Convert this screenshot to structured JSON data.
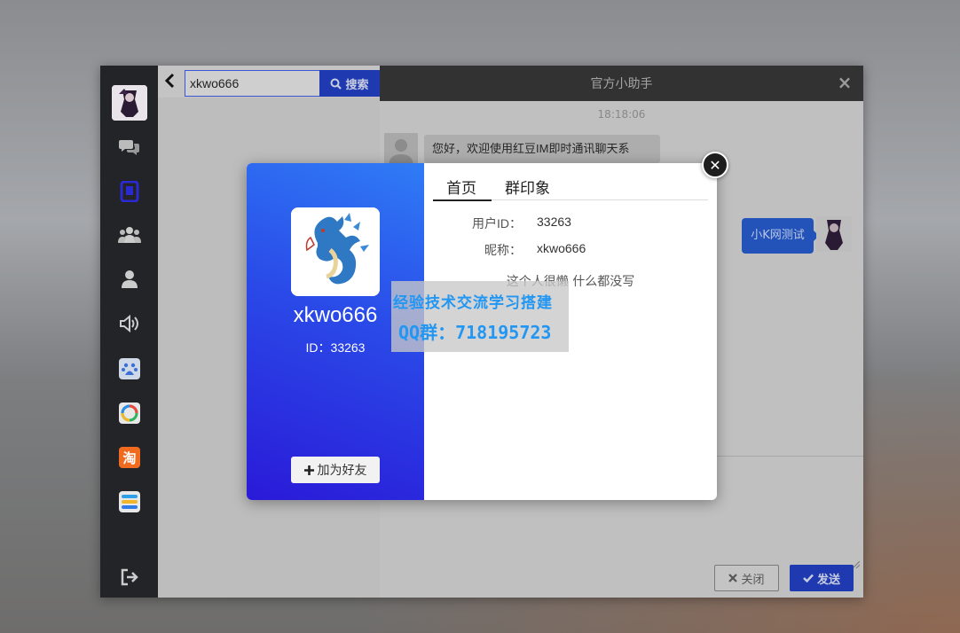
{
  "search": {
    "value": "xkwo666",
    "button_label": "搜索"
  },
  "chat": {
    "title": "官方小助手",
    "timestamp": "18:18:06",
    "incoming_message": "您好，欢迎使用红豆IM即时通讯聊天系",
    "outgoing_message": "小K网测试",
    "close_label": "关闭",
    "send_label": "发送"
  },
  "sidebar": {
    "icons": [
      "chat-icon",
      "tablet-icon",
      "group-icon",
      "contact-icon",
      "speaker-icon",
      "baidu-app-icon",
      "qq-app-icon",
      "taobao-app-icon",
      "layers-app-icon",
      "logout-icon"
    ],
    "taobao_label": "淘"
  },
  "profile": {
    "name": "xkwo666",
    "id_line": "ID：33263",
    "add_friend_label": "加为好友",
    "tabs": [
      "首页",
      "群印象"
    ],
    "fields": [
      {
        "key": "用户ID：",
        "value": "33263"
      },
      {
        "key": "昵称：",
        "value": "xkwo666"
      }
    ],
    "bio": "这个人很懒 什么都没写"
  },
  "watermark": {
    "line1": "经验技术交流学习搭建",
    "line2": "QQ群：718195723"
  },
  "colors": {
    "accent": "#1f3ab0",
    "sidebar_bg": "#232427",
    "profile_gradient_top": "#2f7cf6",
    "profile_gradient_bottom": "#2a1ad8",
    "watermark_text": "#2196f3"
  }
}
